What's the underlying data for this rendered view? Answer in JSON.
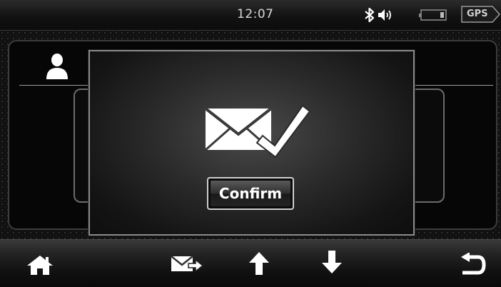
{
  "status_bar": {
    "time": "12:07",
    "icons": [
      "bluetooth-icon",
      "speaker-icon",
      "battery-icon"
    ],
    "gps_label": "GPS"
  },
  "background_screen": {
    "icons": [
      "user-icon"
    ]
  },
  "dialog": {
    "icon": "message-sent-check-icon",
    "confirm_label": "Confirm"
  },
  "nav_bar": {
    "buttons": [
      "home-icon",
      "send-message-icon",
      "arrow-up-icon",
      "arrow-down-icon",
      "back-icon"
    ]
  },
  "colors": {
    "background": "#000000",
    "icon": "#ffffff",
    "dialog_border": "#8a8a8a",
    "button_border": "#cfcfcf"
  }
}
